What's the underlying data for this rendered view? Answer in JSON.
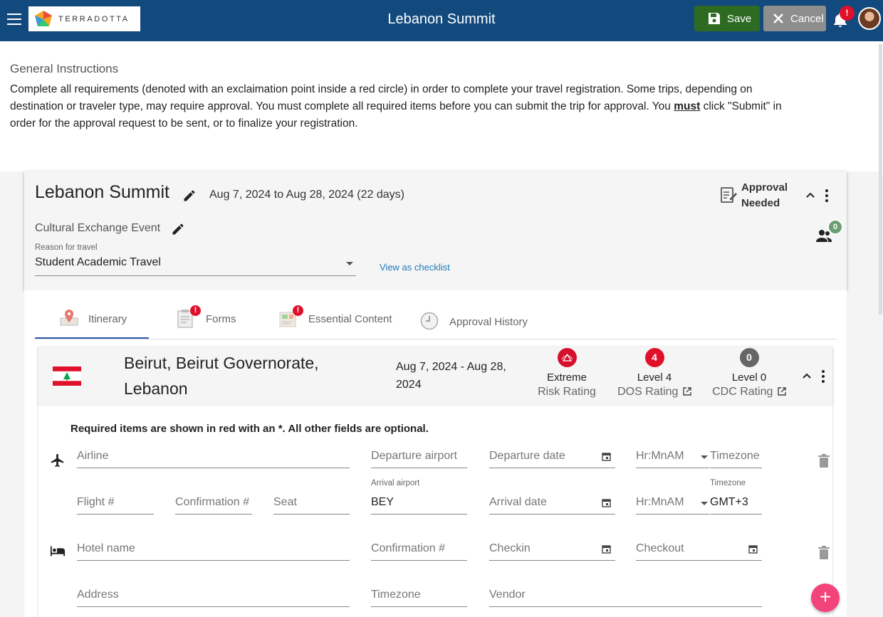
{
  "header": {
    "brand": "TERRADOTTA",
    "title": "Lebanon Summit",
    "save_label": "Save",
    "cancel_label": "Cancel",
    "notification_badge": "!"
  },
  "instructions": {
    "title": "General Instructions",
    "text_before": "Complete all requirements (denoted with an exclaimation point inside a red circle) in order to complete your travel registration.  Some trips, depending on destination or traveler type, may require approval.  You must complete all required items before you can submit the trip for approval. You ",
    "emphasis": "must",
    "text_after": " click \"Submit\" in order for the approval request to be sent, or to finalize your registration."
  },
  "trip": {
    "title": "Lebanon Summit",
    "dates": "Aug 7, 2024 to Aug 28, 2024  (22 days)",
    "approval_status": "Approval Needed",
    "event_type": "Cultural Exchange Event",
    "reason_label": "Reason for travel",
    "reason_value": "Student Academic Travel",
    "view_checklist": "View as checklist",
    "travelers_count": "0"
  },
  "tabs": [
    {
      "label": "Itinerary",
      "alert": false,
      "active": true
    },
    {
      "label": "Forms",
      "alert": true,
      "active": false
    },
    {
      "label": "Essential Content",
      "alert": true,
      "active": false
    },
    {
      "label": "Approval History",
      "alert": false,
      "active": false
    }
  ],
  "destination": {
    "name": "Beirut, Beirut Governorate, Lebanon",
    "dates": "Aug 7, 2024 - Aug 28, 2024",
    "ratings": [
      {
        "badge": "",
        "level": "Extreme",
        "name": "Risk Rating",
        "color": "#d4102a",
        "external": false
      },
      {
        "badge": "4",
        "level": "Level 4",
        "name": "DOS Rating",
        "color": "#e0102a",
        "external": true
      },
      {
        "badge": "0",
        "level": "Level 0",
        "name": "CDC Rating",
        "color": "#666666",
        "external": true
      }
    ],
    "required_note": "Required items are shown in red with an *. All other fields are optional."
  },
  "flight": {
    "airline_ph": "Airline",
    "departure_airport_ph": "Departure airport",
    "departure_date_ph": "Departure date",
    "departure_time_ph": "Hr:MnAM",
    "departure_tz_ph": "Timezone",
    "flight_no_ph": "Flight #",
    "confirmation_ph": "Confirmation #",
    "seat_ph": "Seat",
    "arrival_airport_label": "Arrival airport",
    "arrival_airport_value": "BEY",
    "arrival_date_ph": "Arrival date",
    "arrival_time_ph": "Hr:MnAM",
    "arrival_tz_label": "Timezone",
    "arrival_tz_value": "GMT+3"
  },
  "hotel": {
    "name_ph": "Hotel name",
    "confirmation_ph": "Confirmation #",
    "checkin_ph": "Checkin",
    "checkout_ph": "Checkout",
    "address_ph": "Address",
    "timezone_ph": "Timezone",
    "vendor_ph": "Vendor"
  },
  "fab_label": "+",
  "colors": {
    "topbar": "#134a7d",
    "save": "#2e6b22",
    "cancel": "#8e8e8e",
    "alert": "#e0102a",
    "link": "#1e7cb8",
    "fab": "#f2437b",
    "travelers_badge": "#6b9e73"
  }
}
